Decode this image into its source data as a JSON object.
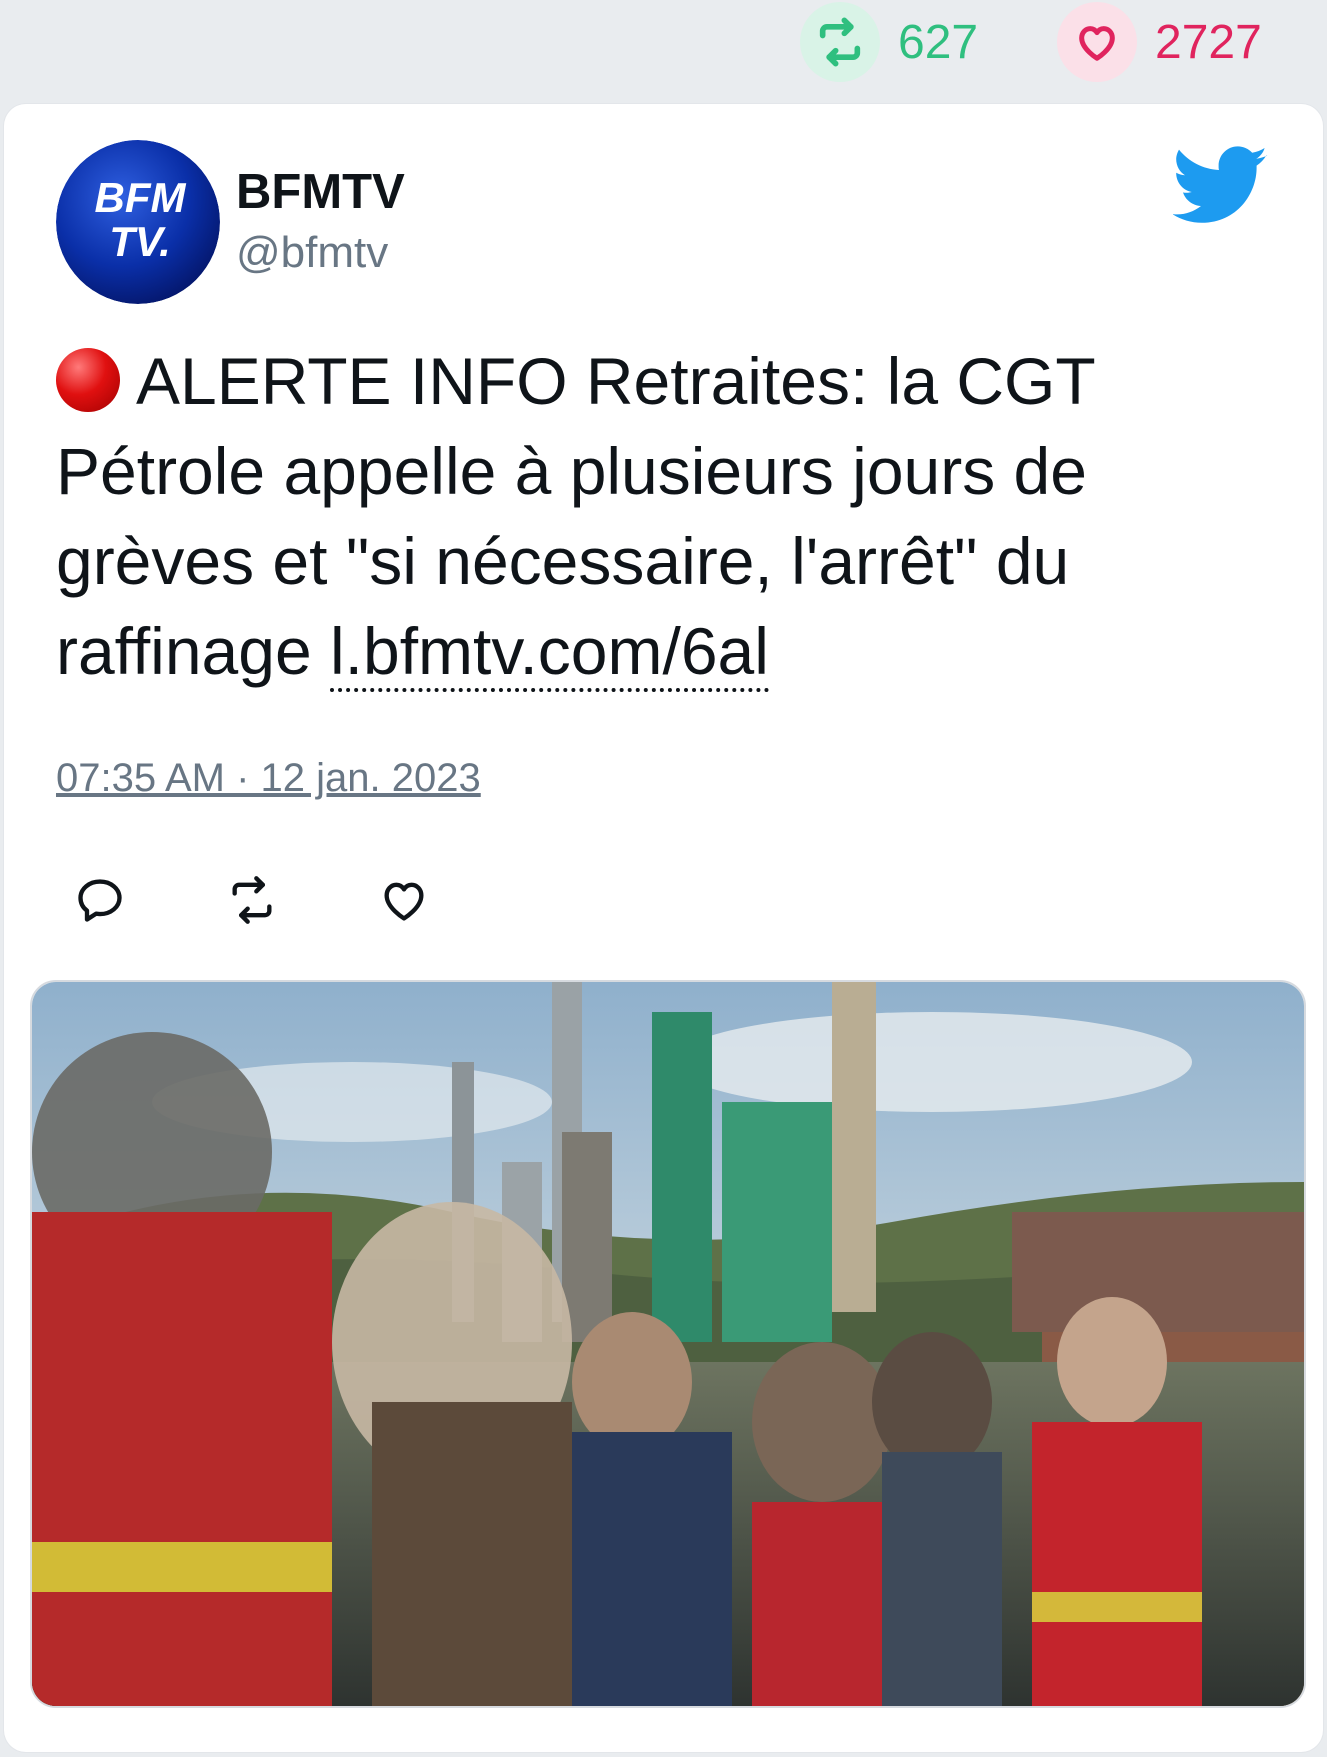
{
  "stats": {
    "retweets": "627",
    "likes": "2727"
  },
  "tweet": {
    "author_name": "BFMTV",
    "author_handle": "@bfmtv",
    "avatar_text_line1": "BFM",
    "avatar_text_line2": "TV.",
    "text": "ALERTE INFO Retraites: la CGT Pétrole appelle à plusieurs jours de grèves et \"si nécessaire, l'arrêt\" du raffinage ",
    "link": "l.bfmtv.com/6al",
    "timestamp": "07:35 AM · 12 jan. 2023"
  },
  "icons": {
    "retweet": "retweet-icon",
    "like": "heart-icon",
    "reply": "reply-icon",
    "brand": "twitter-bird-icon",
    "alert": "red-circle-icon"
  },
  "colors": {
    "retweet_green": "#2fbf7f",
    "like_red": "#e0245e",
    "twitter_blue": "#1d9bf0",
    "muted": "#687684"
  }
}
